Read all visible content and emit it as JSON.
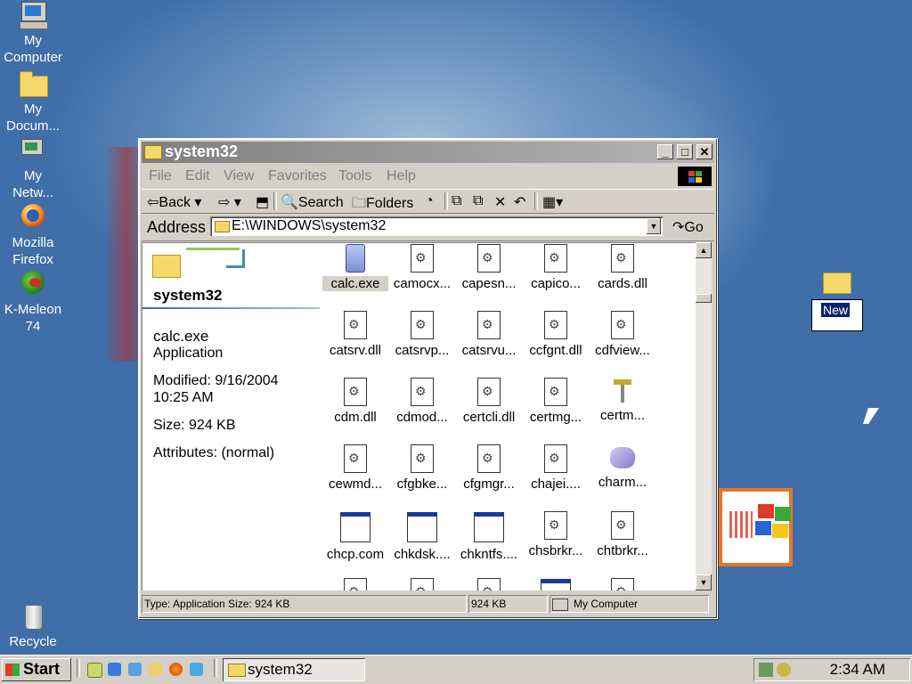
{
  "desktop": {
    "icons": [
      {
        "label1": "My",
        "label2": "Computer"
      },
      {
        "label1": "My",
        "label2": "Docum..."
      },
      {
        "label1": "My",
        "label2": "Netw..."
      },
      {
        "label1": "Mozilla",
        "label2": "Firefox"
      },
      {
        "label1": "K-Meleon",
        "label2": "74"
      },
      {
        "label1": "Recycle",
        "label2": ""
      }
    ],
    "new_folder_label": "New"
  },
  "window": {
    "title": "system32",
    "menu": [
      "File",
      "Edit",
      "View",
      "Favorites",
      "Tools",
      "Help"
    ],
    "toolbar": {
      "back": "Back",
      "search": "Search",
      "folders": "Folders"
    },
    "address": {
      "label": "Address",
      "value": "E:\\WINDOWS\\system32",
      "go": "Go"
    },
    "left_pane": {
      "folder_title": "system32",
      "file_name": "calc.exe",
      "file_type": "Application",
      "modified_line1": "Modified: 9/16/2004",
      "modified_line2": "10:25 AM",
      "size": "Size: 924 KB",
      "attributes": "Attributes: (normal)"
    },
    "files": [
      "calc.exe",
      "camocx...",
      "capesn...",
      "capico...",
      "cards.dll",
      "catsrv.dll",
      "catsrvp...",
      "catsrvu...",
      "ccfgnt.dll",
      "cdfview...",
      "cdm.dll",
      "cdmod...",
      "certcli.dll",
      "certmg...",
      "certm...",
      "cewmd...",
      "cfgbke...",
      "cfgmgr...",
      "chajei....",
      "charm...",
      "chcp.com",
      "chkdsk....",
      "chkntfs....",
      "chsbrkr...",
      "chtbrkr..."
    ],
    "status": {
      "type_size": "Type: Application Size: 924 KB",
      "size": "924 KB",
      "zone": "My Computer"
    }
  },
  "taskbar": {
    "start": "Start",
    "task": "system32",
    "clock": "2:34 AM"
  }
}
